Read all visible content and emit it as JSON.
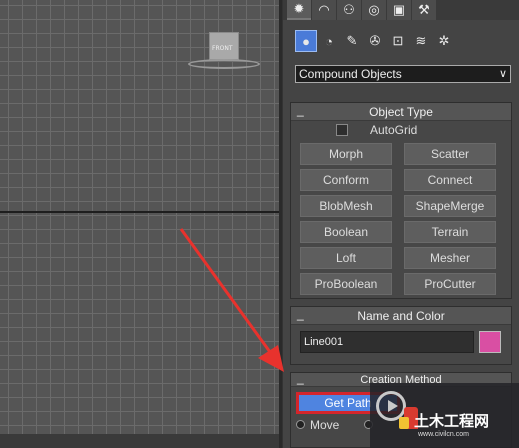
{
  "viewport": {
    "viewcube_label": "FRONT"
  },
  "tabs": [
    {
      "icon": "sun-create-icon",
      "glyph": "✹"
    },
    {
      "icon": "modify-arc-icon",
      "glyph": "◠"
    },
    {
      "icon": "hierarchy-icon",
      "glyph": "⚇"
    },
    {
      "icon": "motion-icon",
      "glyph": "◎"
    },
    {
      "icon": "display-monitor-icon",
      "glyph": "▣"
    },
    {
      "icon": "utilities-hammer-icon",
      "glyph": "⚒"
    }
  ],
  "categories": [
    {
      "icon": "geometry-sphere-icon",
      "glyph": "●"
    },
    {
      "icon": "shapes-icon",
      "glyph": "◔"
    },
    {
      "icon": "lights-icon",
      "glyph": "✎"
    },
    {
      "icon": "cameras-icon",
      "glyph": "✇"
    },
    {
      "icon": "helpers-icon",
      "glyph": "⊡"
    },
    {
      "icon": "space-warps-icon",
      "glyph": "≋"
    },
    {
      "icon": "systems-icon",
      "glyph": "✲"
    }
  ],
  "dropdown": {
    "value": "Compound Objects"
  },
  "object_type": {
    "title": "Object Type",
    "autogrid": "AutoGrid",
    "buttons": [
      "Morph",
      "Scatter",
      "Conform",
      "Connect",
      "BlobMesh",
      "ShapeMerge",
      "Boolean",
      "Terrain",
      "Loft",
      "Mesher",
      "ProBoolean",
      "ProCutter"
    ]
  },
  "name_color": {
    "title": "Name and Color",
    "name": "Line001",
    "color": "#d94fa3"
  },
  "creation_method": {
    "title": "Creation Method",
    "get_path": "Get Path",
    "move": "Move"
  },
  "watermark": {
    "text": "土木工程网",
    "url": "www.civilcn.com"
  },
  "colors": {
    "accent": "#4f84e0",
    "highlight_border": "#d4252b",
    "arrow": "#e8322d"
  }
}
